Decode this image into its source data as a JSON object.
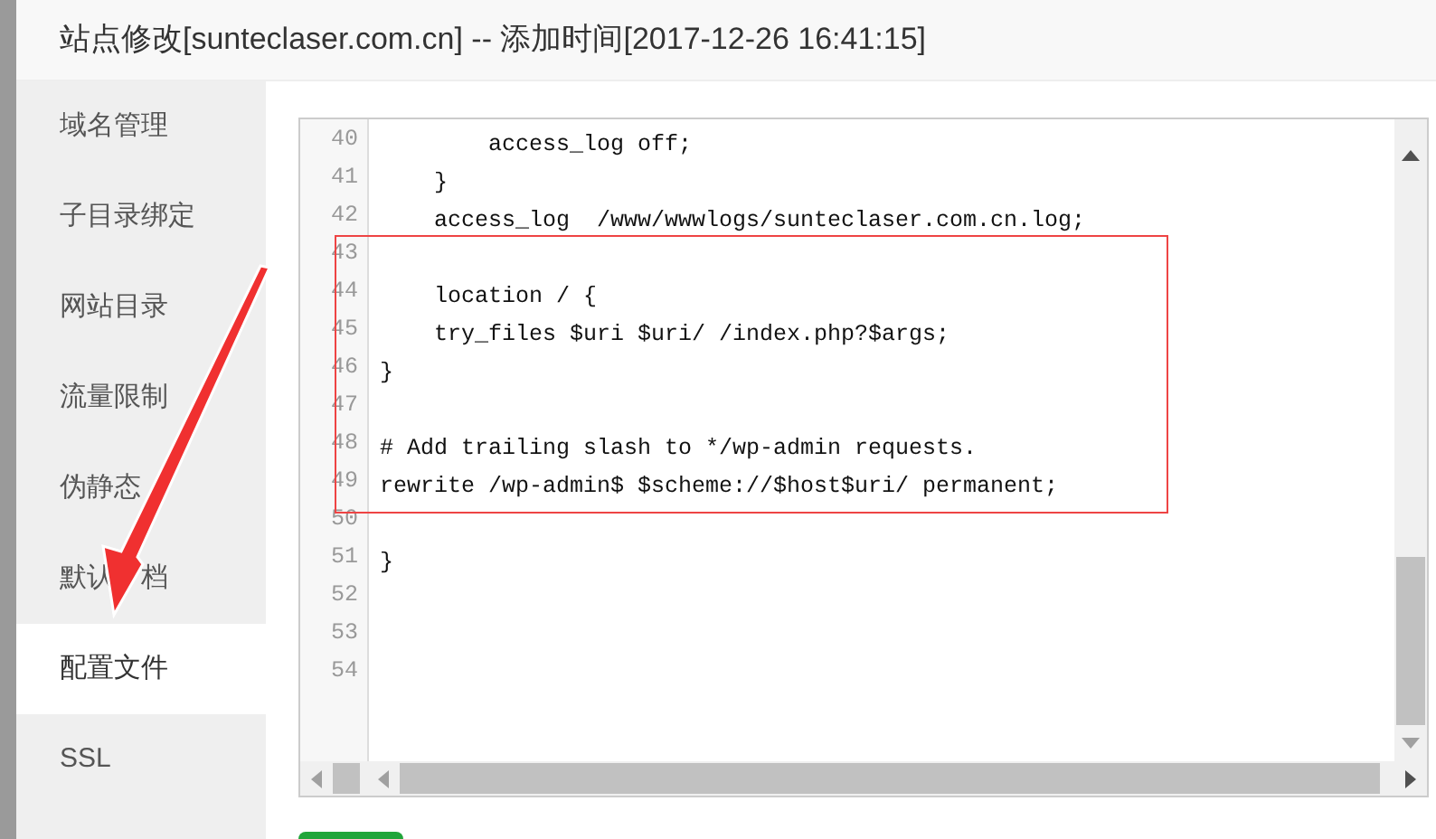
{
  "dialog": {
    "title": "站点修改[sunteclaser.com.cn] -- 添加时间[2017-12-26 16:41:15]"
  },
  "sidebar": {
    "items": [
      {
        "label": "域名管理",
        "selected": false
      },
      {
        "label": "子目录绑定",
        "selected": false
      },
      {
        "label": "网站目录",
        "selected": false
      },
      {
        "label": "流量限制",
        "selected": false
      },
      {
        "label": "伪静态",
        "selected": false
      },
      {
        "label": "默认　档",
        "selected": false
      },
      {
        "label": "配置文件",
        "selected": true
      },
      {
        "label": "SSL",
        "selected": false
      }
    ]
  },
  "editor": {
    "lines": [
      {
        "number": "40",
        "code": "        access_log off;"
      },
      {
        "number": "41",
        "code": "    }"
      },
      {
        "number": "42",
        "code": "    access_log  /www/wwwlogs/sunteclaser.com.cn.log;"
      },
      {
        "number": "43"
      },
      {
        "number": "44",
        "code": "    location / {"
      },
      {
        "number": "45",
        "code": "    try_files $uri $uri/ /index.php?$args;"
      },
      {
        "number": "46",
        "code": "}"
      },
      {
        "number": "47"
      },
      {
        "number": "48",
        "code": "# Add trailing slash to */wp-admin requests."
      },
      {
        "number": "49",
        "code": "rewrite /wp-admin$ $scheme://$host$uri/ permanent;"
      },
      {
        "number": "50"
      },
      {
        "number": "51",
        "code": "}"
      },
      {
        "number": "52"
      },
      {
        "number": "53"
      },
      {
        "number": "54"
      }
    ]
  }
}
